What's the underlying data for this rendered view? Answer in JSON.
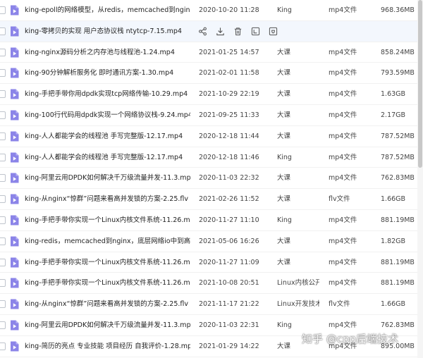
{
  "files": [
    {
      "name": "king-epoll的网络模型，从redis，memcached到nginx-...",
      "date": "2020-10-20 11:28",
      "owner": "King",
      "type": "mp4文件",
      "size": "968.36MB"
    },
    {
      "name": "king-零拷贝的实现 用户态协议栈 ntytcp-7.15.mp4",
      "date": "",
      "owner": "",
      "type": "",
      "size": "",
      "hover": true
    },
    {
      "name": "king-nginx源码分析之内存池与线程池-1.24.mp4",
      "date": "2021-01-25 14:57",
      "owner": "大课",
      "type": "mp4文件",
      "size": "858.24MB"
    },
    {
      "name": "king-90分钟解析服务化 即时通讯方案-1.30.mp4",
      "date": "2021-02-01 11:58",
      "owner": "大课",
      "type": "mp4文件",
      "size": "793.59MB"
    },
    {
      "name": "king-手把手带你用dpdk实现tcp网络传输-10.29.mp4",
      "date": "2021-10-29 22:19",
      "owner": "大课",
      "type": "mp4文件",
      "size": "1.63GB"
    },
    {
      "name": "king-100行代码用dpdk实现一个网络协议栈-9.24.mp4",
      "date": "2021-09-25 11:33",
      "owner": "大课",
      "type": "mp4文件",
      "size": "2.17GB"
    },
    {
      "name": "king-人人都能学会的线程池 手写完整版-12.17.mp4",
      "date": "2020-12-18 11:44",
      "owner": "大课",
      "type": "mp4文件",
      "size": "787.52MB"
    },
    {
      "name": "king-人人都能学会的线程池 手写完整版-12.17.mp4",
      "date": "2020-12-18 11:46",
      "owner": "King",
      "type": "mp4文件",
      "size": "787.52MB"
    },
    {
      "name": "king-阿里云用DPDK如何解决千万级流量并发-11.3.mp4",
      "date": "2020-11-03 22:32",
      "owner": "大课",
      "type": "mp4文件",
      "size": "762.83MB"
    },
    {
      "name": "king-从nginx“惊群”问题来看高并发锁的方案-2.25.flv",
      "date": "2021-02-26 11:52",
      "owner": "大课",
      "type": "flv文件",
      "size": "1.66GB"
    },
    {
      "name": "king-手把手带你实现一个Linux内核文件系统-11.26.mp4",
      "date": "2020-11-27 11:10",
      "owner": "King",
      "type": "mp4文件",
      "size": "881.19MB"
    },
    {
      "name": "king-redis，memcached到nginx，底层网络io中到高精...",
      "date": "2021-05-06 16:26",
      "owner": "大课",
      "type": "mp4文件",
      "size": "1.82GB"
    },
    {
      "name": "king-手把手带你实现一个Linux内核文件系统-11.26.mp4",
      "date": "2020-11-27 11:09",
      "owner": "大课",
      "type": "mp4文件",
      "size": "881.19MB"
    },
    {
      "name": "king-手把手带你实现一个Linux内核文件系统-11.26.mp4",
      "date": "2021-10-08 20:51",
      "owner": "Linux内核公开...",
      "type": "mp4文件",
      "size": "881.19MB"
    },
    {
      "name": "king-从nginx“惊群”问题来看高并发锁的方案-2.25.flv",
      "date": "2021-11-17 21:22",
      "owner": "Linux开发技术...",
      "type": "flv文件",
      "size": "1.66GB"
    },
    {
      "name": "king-阿里云用DPDK如何解决千万级流量并发-11.3.mp4",
      "date": "2020-11-03 22:31",
      "owner": "King",
      "type": "mp4文件",
      "size": "762.83MB"
    },
    {
      "name": "king-简历的亮点 专业技能 项目经历 自我评价-1.28.mp4",
      "date": "2021-01-29 14:22",
      "owner": "大课",
      "type": "mp4文件",
      "size": "895.00MB"
    }
  ],
  "hover_actions": [
    "share-icon",
    "download-icon",
    "delete-icon",
    "rename-icon",
    "more-icon"
  ],
  "watermark": "知乎 @cpp后端技术",
  "colors": {
    "video_icon": "#8b84e8",
    "hover_row": "#f3f7fd"
  }
}
